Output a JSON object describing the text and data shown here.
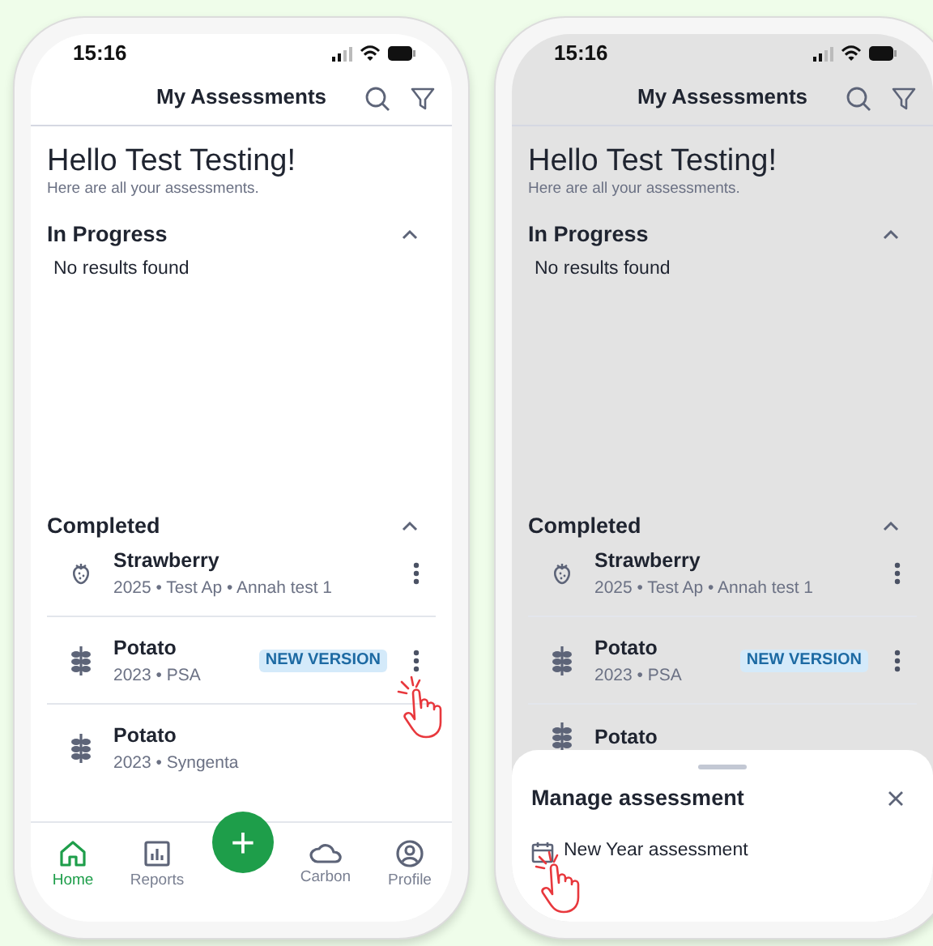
{
  "phones": [
    {
      "dimmed": false,
      "status_time": "15:16",
      "title": "My Assessments",
      "greeting": "Hello Test Testing!",
      "subtitle": "Here are all your assessments.",
      "sections": [
        {
          "title": "In Progress",
          "expanded": true,
          "empty_text": "No results found"
        },
        {
          "title": "Completed",
          "expanded": true,
          "items": [
            {
              "kind": "berry",
              "title": "Strawberry",
              "subtitle": "2025 • Test Ap • Annah test 1",
              "menu": true,
              "menu_tapped": false
            },
            {
              "kind": "grain",
              "title": "Potato",
              "subtitle": "2023 • PSA",
              "badge": "NEW VERSION",
              "menu": true,
              "menu_tapped": true
            },
            {
              "kind": "grain",
              "title": "Potato",
              "subtitle": "2023 • Syngenta",
              "menu": false,
              "menu_tapped": false
            }
          ]
        }
      ],
      "fab": {
        "label": "+"
      },
      "nav": [
        {
          "kind": "home",
          "label": "Home",
          "selected": true
        },
        {
          "kind": "reports",
          "label": "Reports",
          "selected": false
        },
        {
          "kind": "carbon",
          "label": "Carbon",
          "selected": false
        },
        {
          "kind": "profile",
          "label": "Profile",
          "selected": false
        }
      ]
    },
    {
      "dimmed": true,
      "status_time": "15:16",
      "title": "My Assessments",
      "greeting": "Hello Test Testing!",
      "subtitle": "Here are all your assessments.",
      "sections": [
        {
          "title": "In Progress",
          "expanded": true,
          "empty_text": "No results found"
        },
        {
          "title": "Completed",
          "expanded": true,
          "items": [
            {
              "kind": "berry",
              "title": "Strawberry",
              "subtitle": "2025 • Test Ap • Annah test 1",
              "menu": true,
              "menu_tapped": false
            },
            {
              "kind": "grain",
              "title": "Potato",
              "subtitle": "2023 • PSA",
              "badge": "NEW VERSION",
              "menu": true,
              "menu_tapped": false
            },
            {
              "kind": "grain",
              "title": "Potato",
              "menu": false,
              "menu_tapped": false
            }
          ]
        }
      ],
      "sheet": {
        "title": "Manage assessment",
        "options": [
          {
            "label": "New Year assessment",
            "tapped": true
          }
        ]
      }
    }
  ]
}
